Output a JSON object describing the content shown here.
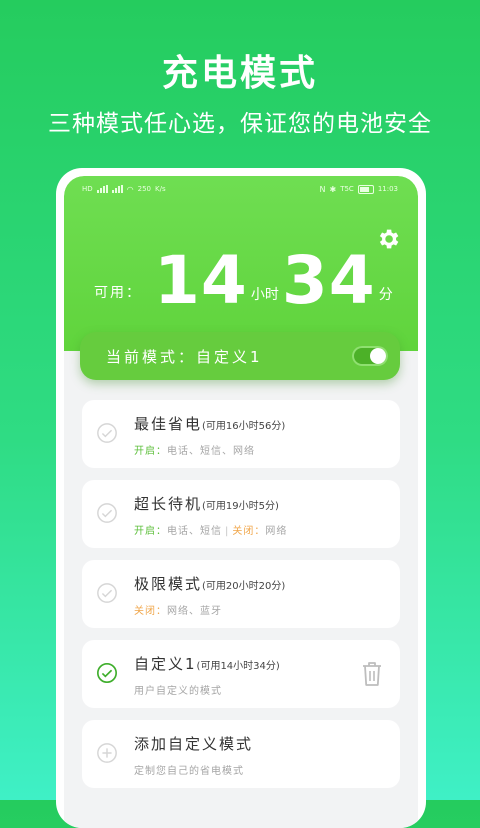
{
  "promo": {
    "title": "充电模式",
    "subtitle": "三种模式任心选，保证您的电池安全"
  },
  "statusbar": {
    "left_net": "HD",
    "left_speed": "250",
    "left_speed_unit": "K/s",
    "right_signal": "T5C",
    "time": "11:03"
  },
  "hero": {
    "available_label": "可用：",
    "hours": "14",
    "hours_unit": "小时",
    "minutes": "34",
    "minutes_unit": "分"
  },
  "current_mode": {
    "label": "当前模式：自定义1",
    "toggle_on": true
  },
  "modes": [
    {
      "title": "最佳省电",
      "sub": "(可用16小时56分)",
      "desc_on": "开启：",
      "desc_on_items": "电话、短信、网络",
      "desc_off": "",
      "desc_off_items": ""
    },
    {
      "title": "超长待机",
      "sub": "(可用19小时5分)",
      "desc_on": "开启：",
      "desc_on_items": "电话、短信",
      "desc_off": "关闭：",
      "desc_off_items": "网络"
    },
    {
      "title": "极限模式",
      "sub": "(可用20小时20分)",
      "desc_on": "",
      "desc_on_items": "",
      "desc_off": "关闭：",
      "desc_off_items": "网络、蓝牙"
    },
    {
      "title": "自定义1",
      "sub": "(可用14小时34分)",
      "desc": "用户自定义的模式",
      "selected": true
    },
    {
      "title": "添加自定义模式",
      "desc": "定制您自己的省电模式"
    }
  ],
  "colors": {
    "accent": "#5cbf3a",
    "off": "#f0a64a",
    "hero": "#66d645"
  },
  "icons": {
    "settings": "gear-icon",
    "check": "check-circle-icon",
    "delete": "trash-icon",
    "add": "plus-circle-icon"
  }
}
